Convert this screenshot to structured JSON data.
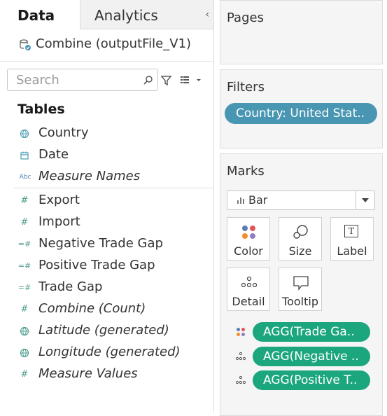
{
  "tabs": {
    "data": "Data",
    "analytics": "Analytics",
    "collapse": "‹"
  },
  "datasource": {
    "name": "Combine (outputFile_V1)"
  },
  "search": {
    "placeholder": "Search",
    "value": ""
  },
  "tables_heading": "Tables",
  "dimensions": [
    {
      "label": "Country",
      "icon": "globe-icon"
    },
    {
      "label": "Date",
      "icon": "calendar-icon"
    },
    {
      "label": "Measure Names",
      "icon": "abc-icon"
    }
  ],
  "measures": [
    {
      "label": "Export",
      "icon": "hash-icon"
    },
    {
      "label": "Import",
      "icon": "hash-icon"
    },
    {
      "label": "Negative Trade Gap",
      "icon": "calc-hash-icon"
    },
    {
      "label": "Positive Trade Gap",
      "icon": "calc-hash-icon"
    },
    {
      "label": "Trade Gap",
      "icon": "calc-hash-icon"
    },
    {
      "label": "Combine (Count)",
      "icon": "hash-icon"
    },
    {
      "label": "Latitude (generated)",
      "icon": "globe-icon"
    },
    {
      "label": "Longitude (generated)",
      "icon": "globe-icon"
    },
    {
      "label": "Measure Values",
      "icon": "hash-icon"
    }
  ],
  "icon_glyphs": {
    "abc": "Abc",
    "hash": "#",
    "calc_hash": "=#"
  },
  "pages": {
    "title": "Pages"
  },
  "filters": {
    "title": "Filters",
    "pill": "Country: United Stat.."
  },
  "marks": {
    "title": "Marks",
    "mark_type": "Bar",
    "buttons": {
      "color": "Color",
      "size": "Size",
      "label": "Label",
      "detail": "Detail",
      "tooltip": "Tooltip"
    },
    "label_glyph": "T",
    "pills": [
      {
        "label": "AGG(Trade Ga..",
        "icon": "color-icon"
      },
      {
        "label": "AGG(Negative ..",
        "icon": "detail-icon"
      },
      {
        "label": "AGG(Positive T..",
        "icon": "detail-icon"
      }
    ]
  },
  "colors": {
    "filter_pill": "#4996b2",
    "measure_pill": "#1ba67e",
    "field_icon": "#4e9f8e"
  }
}
